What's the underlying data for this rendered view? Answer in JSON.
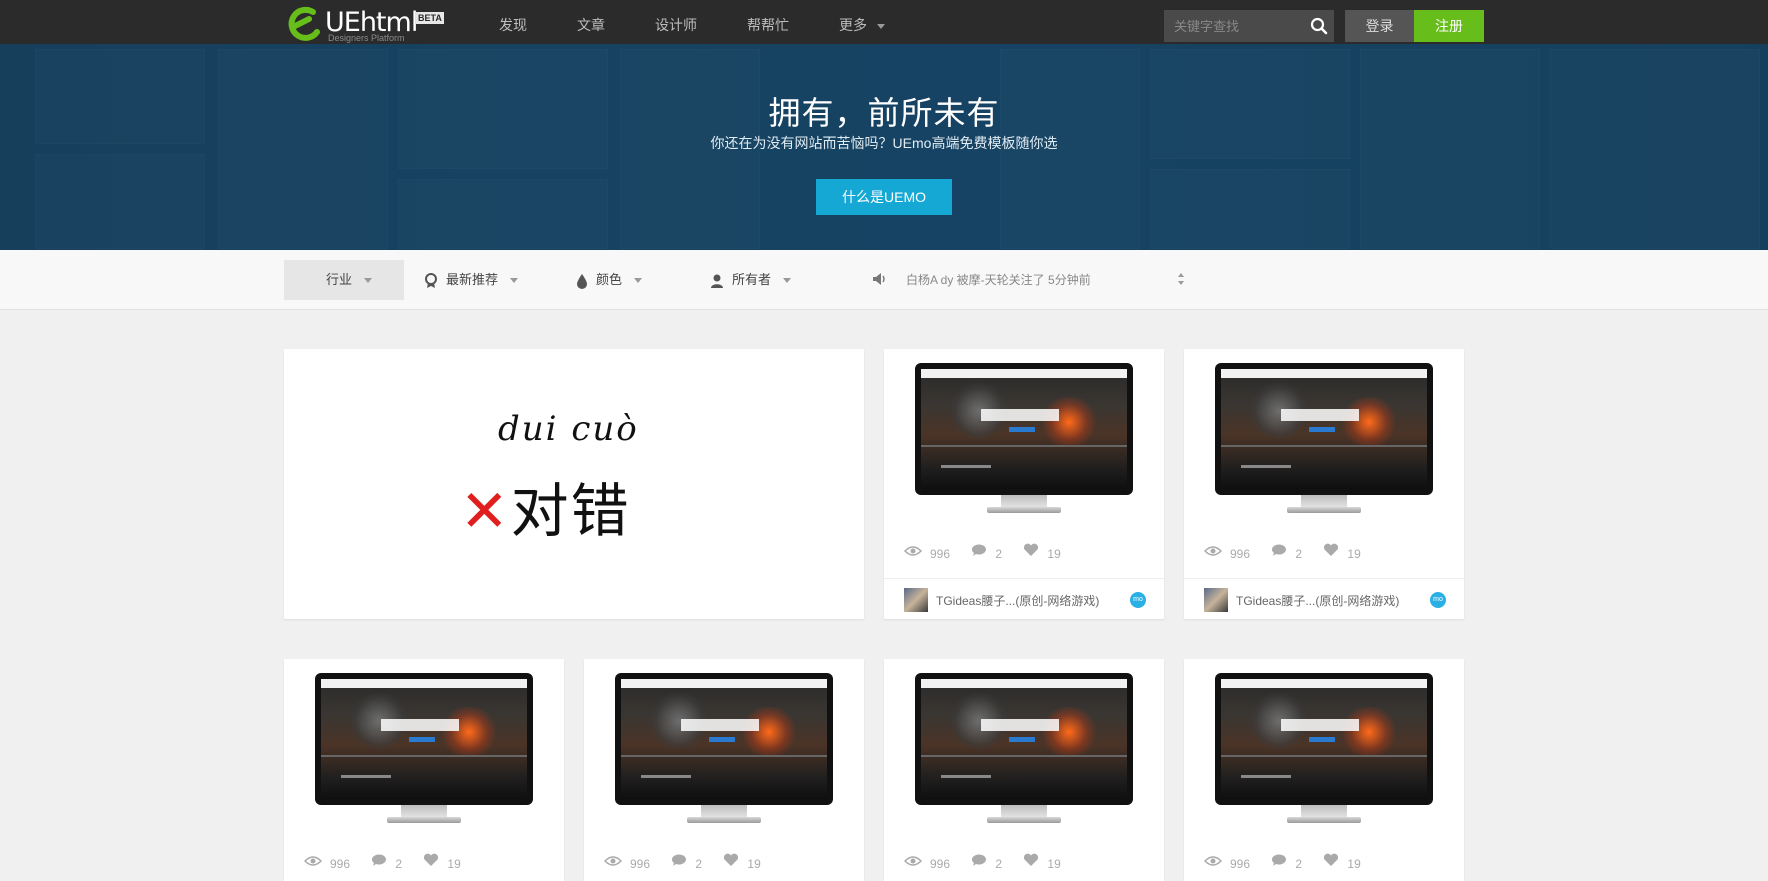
{
  "header": {
    "logo_text": "UEhtml",
    "logo_badge": "BETA",
    "logo_sub": "Designers Platform",
    "nav": [
      "发现",
      "文章",
      "设计师",
      "帮帮忙",
      "更多"
    ],
    "search_placeholder": "关键字查找",
    "login_label": "登录",
    "register_label": "注册",
    "accent_color": "#67bd1a"
  },
  "hero": {
    "title": "拥有，前所未有",
    "subtitle": "你还在为没有网站而苦恼吗？UEmo高端免费模板随你选",
    "button_label": "什么是UEMO",
    "button_color": "#16a8d4"
  },
  "filters": {
    "items": [
      "行业",
      "最新推荐",
      "颜色",
      "所有者"
    ],
    "notice": "白杨A dy 被摩-天轮关注了 5分钟前"
  },
  "feature_card": {
    "pinyin": "dui cuò",
    "hanzi": "对错"
  },
  "cards": [
    {
      "views": "996",
      "comments": "2",
      "likes": "19",
      "author": "TGideas腰子...(原创-网络游戏)",
      "badge": "mo"
    },
    {
      "views": "996",
      "comments": "2",
      "likes": "19",
      "author": "TGideas腰子...(原创-网络游戏)",
      "badge": "mo"
    },
    {
      "views": "996",
      "comments": "2",
      "likes": "19"
    },
    {
      "views": "996",
      "comments": "2",
      "likes": "19"
    },
    {
      "views": "996",
      "comments": "2",
      "likes": "19"
    },
    {
      "views": "996",
      "comments": "2",
      "likes": "19"
    }
  ]
}
